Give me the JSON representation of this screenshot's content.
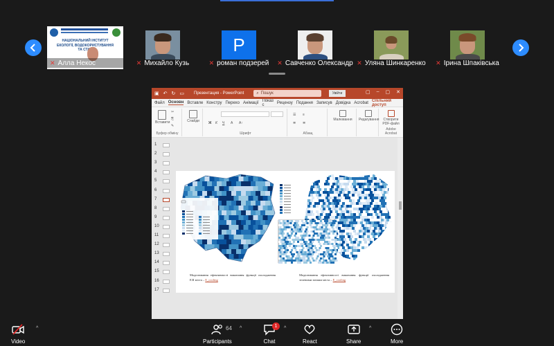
{
  "gallery": {
    "participants": [
      {
        "name": "Алла Некос",
        "muted": true,
        "type": "screen",
        "slide_lines": [
          "НАЦІОНАЛЬНИЙ ІНСТИТУТ",
          "ЕКОЛОГІЇ, ВОДОКОРИСТУВАННЯ",
          "ТА СТАЛ"
        ]
      },
      {
        "name": "Михайло Кузь",
        "muted": true,
        "type": "photo"
      },
      {
        "name": "роман подзерей",
        "muted": true,
        "type": "initial",
        "initial": "P"
      },
      {
        "name": "Савченко Олександр",
        "muted": true,
        "type": "photo"
      },
      {
        "name": "Уляна Шинкаренко",
        "muted": true,
        "type": "photo"
      },
      {
        "name": "Ірина Шпаківська",
        "muted": true,
        "type": "photo"
      }
    ]
  },
  "ppt": {
    "title": "Презентация - PowerPoint",
    "search_placeholder": "Пошук",
    "sign_in": "Увійти",
    "tabs": [
      "Файл",
      "Основн",
      "Вставле",
      "Констру",
      "Перехо",
      "Анімації",
      "Показ с",
      "Рецензу",
      "Подання",
      "Записув",
      "Довідка",
      "Acrobat"
    ],
    "share_access": "Спільний доступ",
    "ribbon": {
      "clipboard_label": "Буфер обміну",
      "paste_label": "Вставити",
      "slides_label": "Слайди",
      "font_label": "Шрифт",
      "paragraph_label": "Абзац",
      "drawing_label": "Малювання",
      "editing_label": "Редагування",
      "acrobat_btn": "Створити PDF-файл",
      "acrobat_label": "Adobe Acrobat"
    },
    "slide_numbers": [
      "1",
      "2",
      "3",
      "4",
      "5",
      "6",
      "7",
      "8",
      "9",
      "10",
      "11",
      "12",
      "13",
      "14",
      "15",
      "16",
      "17"
    ],
    "selected_slide": "7",
    "captions": {
      "left": "Моделювання ефективності виконання функції охолодження ЕЗІ міста –",
      "left_hl": "E_cooling",
      "right": "Моделювання ефективності виконання функції охолодження зеленими зонами міста –",
      "right_hl": "E_cooling"
    }
  },
  "toolbar": {
    "video": "Video",
    "participants": "Participants",
    "participants_count": "64",
    "chat": "Chat",
    "chat_badge": "1",
    "react": "React",
    "share": "Share",
    "more": "More"
  },
  "colors": {
    "zoom_blue": "#2d8cff",
    "ppt_red": "#b7472a",
    "mute_red": "#e53935",
    "map_blue": "#2b6cb0"
  }
}
